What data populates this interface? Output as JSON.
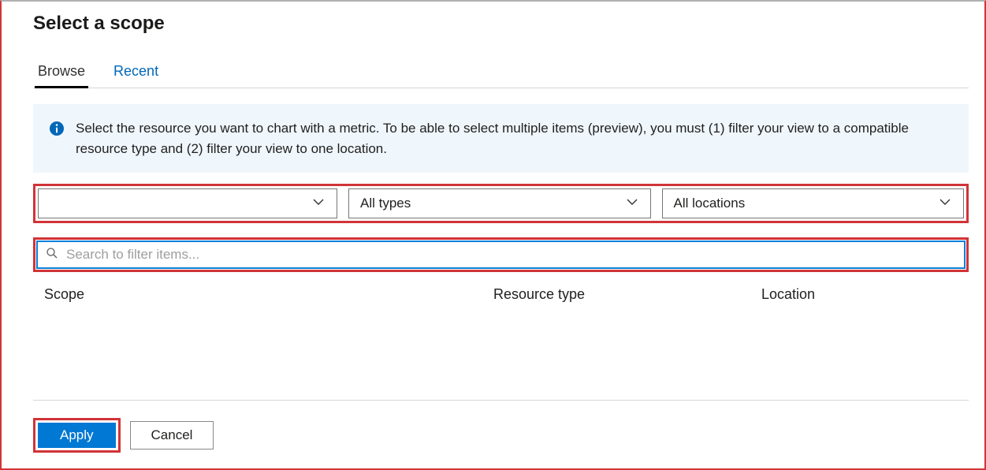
{
  "title": "Select a scope",
  "tabs": {
    "browse": "Browse",
    "recent": "Recent"
  },
  "info_text": "Select the resource you want to chart with a metric. To be able to select multiple items (preview), you must (1) filter your view to a compatible resource type and (2) filter your view to one location.",
  "filters": {
    "subscription": "",
    "type": "All types",
    "location": "All locations"
  },
  "search": {
    "placeholder": "Search to filter items...",
    "value": ""
  },
  "columns": {
    "scope": "Scope",
    "resource_type": "Resource type",
    "location": "Location"
  },
  "buttons": {
    "apply": "Apply",
    "cancel": "Cancel"
  }
}
